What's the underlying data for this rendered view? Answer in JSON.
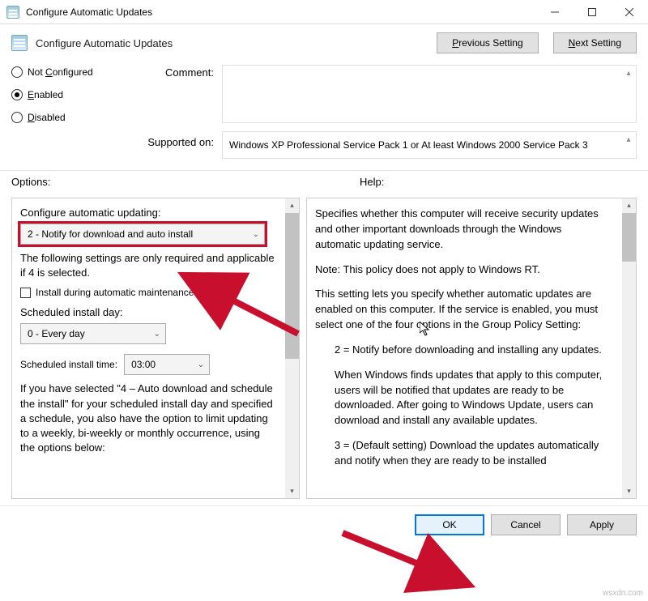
{
  "window": {
    "title": "Configure Automatic Updates"
  },
  "header": {
    "title": "Configure Automatic Updates",
    "prev": "Previous Setting",
    "next": "Next Setting"
  },
  "state": {
    "not_configured": "Not Configured",
    "enabled": "Enabled",
    "disabled": "Disabled",
    "selected": "enabled"
  },
  "comment_label": "Comment:",
  "comment_value": "",
  "supported_label": "Supported on:",
  "supported_value": "Windows XP Professional Service Pack 1 or At least Windows 2000 Service Pack 3",
  "options_label": "Options:",
  "help_label": "Help:",
  "options": {
    "heading": "Configure automatic updating:",
    "mode_selected": "2 - Notify for download and auto install",
    "note": "The following settings are only required and applicable if 4 is selected.",
    "checkbox_label": "Install during automatic maintenance",
    "day_label": "Scheduled install day:",
    "day_selected": "0 - Every day",
    "time_label": "Scheduled install time:",
    "time_selected": "03:00",
    "tail": "If you have selected \"4 – Auto download and schedule the install\" for your scheduled install day and specified a schedule, you also have the option to limit updating to a weekly, bi-weekly or monthly occurrence, using the options below:"
  },
  "help": {
    "p1": "Specifies whether this computer will receive security updates and other important downloads through the Windows automatic updating service.",
    "p2": "Note: This policy does not apply to Windows RT.",
    "p3": "This setting lets you specify whether automatic updates are enabled on this computer. If the service is enabled, you must select one of the four options in the Group Policy Setting:",
    "p4": "2 = Notify before downloading and installing any updates.",
    "p5": "When Windows finds updates that apply to this computer, users will be notified that updates are ready to be downloaded. After going to Windows Update, users can download and install any available updates.",
    "p6": "3 = (Default setting) Download the updates automatically and notify when they are ready to be installed"
  },
  "buttons": {
    "ok": "OK",
    "cancel": "Cancel",
    "apply": "Apply"
  }
}
